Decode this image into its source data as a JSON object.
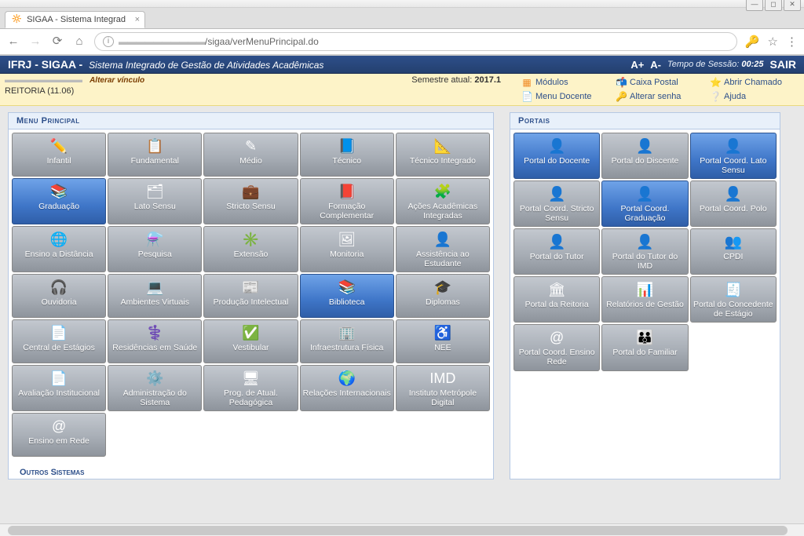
{
  "browser": {
    "tab_title": "SIGAA - Sistema Integrad",
    "url_display": "/sigaa/verMenuPrincipal.do"
  },
  "header": {
    "brand": "IFRJ - SIGAA -",
    "subtitle": "Sistema Integrado de Gestão de Atividades Acadêmicas",
    "font_increase": "A+",
    "font_decrease": "A-",
    "session_label": "Tempo de Sessão:",
    "session_time": "00:25",
    "logout": "SAIR"
  },
  "info_strip": {
    "alterar_vinculo": "Alterar vínculo",
    "department": "REITORIA (11.06)",
    "semestre_label": "Semestre atual:",
    "semestre_value": "2017.1",
    "links": {
      "modulos": "Módulos",
      "caixa_postal": "Caixa Postal",
      "abrir_chamado": "Abrir Chamado",
      "menu_docente": "Menu Docente",
      "alterar_senha": "Alterar senha",
      "ajuda": "Ajuda"
    }
  },
  "menu_principal": {
    "title": "Menu Principal",
    "items": [
      {
        "label": "Infantil",
        "icon": "✏️"
      },
      {
        "label": "Fundamental",
        "icon": "📋"
      },
      {
        "label": "Médio",
        "icon": "✎"
      },
      {
        "label": "Técnico",
        "icon": "📘"
      },
      {
        "label": "Técnico Integrado",
        "icon": "📐"
      },
      {
        "label": "Graduação",
        "icon": "📚",
        "active": true
      },
      {
        "label": "Lato Sensu",
        "icon": "🗂"
      },
      {
        "label": "Stricto Sensu",
        "icon": "💼"
      },
      {
        "label": "Formação Complementar",
        "icon": "📕"
      },
      {
        "label": "Ações Acadêmicas Integradas",
        "icon": "🧩"
      },
      {
        "label": "Ensino a Distância",
        "icon": "🌐"
      },
      {
        "label": "Pesquisa",
        "icon": "⚗️"
      },
      {
        "label": "Extensão",
        "icon": "✳️"
      },
      {
        "label": "Monitoria",
        "icon": "🖼"
      },
      {
        "label": "Assistência ao Estudante",
        "icon": "👤"
      },
      {
        "label": "Ouvidoria",
        "icon": "🎧"
      },
      {
        "label": "Ambientes Virtuais",
        "icon": "💻"
      },
      {
        "label": "Produção Intelectual",
        "icon": "📰"
      },
      {
        "label": "Biblioteca",
        "icon": "📚",
        "active": true
      },
      {
        "label": "Diplomas",
        "icon": "🎓"
      },
      {
        "label": "Central de Estágios",
        "icon": "📄"
      },
      {
        "label": "Residências em Saúde",
        "icon": "⚕️"
      },
      {
        "label": "Vestibular",
        "icon": "✅"
      },
      {
        "label": "Infraestrutura Física",
        "icon": "🏢"
      },
      {
        "label": "NEE",
        "icon": "♿"
      },
      {
        "label": "Avaliação Institucional",
        "icon": "📄"
      },
      {
        "label": "Administração do Sistema",
        "icon": "⚙️"
      },
      {
        "label": "Prog. de Atual. Pedagógica",
        "icon": "🖥"
      },
      {
        "label": "Relações Internacionais",
        "icon": "🌍"
      },
      {
        "label": "Instituto Metrópole Digital",
        "icon": "IMD"
      },
      {
        "label": "Ensino em Rede",
        "icon": "@"
      }
    ]
  },
  "portais": {
    "title": "Portais",
    "items": [
      {
        "label": "Portal do Docente",
        "icon": "👤",
        "active": true
      },
      {
        "label": "Portal do Discente",
        "icon": "👤"
      },
      {
        "label": "Portal Coord. Lato Sensu",
        "icon": "👤",
        "active": true
      },
      {
        "label": "Portal Coord. Stricto Sensu",
        "icon": "👤"
      },
      {
        "label": "Portal Coord. Graduação",
        "icon": "👤",
        "active": true
      },
      {
        "label": "Portal Coord. Polo",
        "icon": "👤"
      },
      {
        "label": "Portal do Tutor",
        "icon": "👤"
      },
      {
        "label": "Portal do Tutor do IMD",
        "icon": "👤"
      },
      {
        "label": "CPDI",
        "icon": "👥"
      },
      {
        "label": "Portal da Reitoria",
        "icon": "🏛"
      },
      {
        "label": "Relatórios de Gestão",
        "icon": "📊"
      },
      {
        "label": "Portal do Concedente de Estágio",
        "icon": "🧾"
      },
      {
        "label": "Portal Coord. Ensino Rede",
        "icon": "@"
      },
      {
        "label": "Portal do Familiar",
        "icon": "👪"
      }
    ]
  },
  "outros_sistemas": {
    "title": "Outros Sistemas"
  }
}
